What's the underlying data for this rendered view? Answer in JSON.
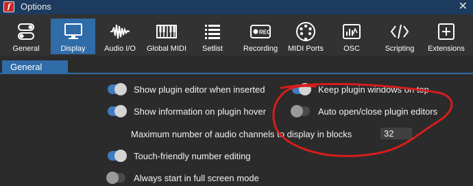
{
  "window": {
    "title": "Options",
    "close_glyph": "✕",
    "app_icon_letter": "f"
  },
  "toolbar": {
    "items": [
      {
        "label": "General",
        "icon": "toggles-icon",
        "active": false
      },
      {
        "label": "Display",
        "icon": "monitor-icon",
        "active": true
      },
      {
        "label": "Audio I/O",
        "icon": "waveform-icon",
        "active": false
      },
      {
        "label": "Global MIDI",
        "icon": "keyboard-icon",
        "active": false
      },
      {
        "label": "Setlist",
        "icon": "list-icon",
        "active": false
      },
      {
        "label": "Recording",
        "icon": "rec-icon",
        "active": false
      },
      {
        "label": "MIDI Ports",
        "icon": "midi-port-icon",
        "active": false
      },
      {
        "label": "OSC",
        "icon": "osc-icon",
        "active": false
      },
      {
        "label": "Scripting",
        "icon": "code-icon",
        "active": false
      },
      {
        "label": "Extensions",
        "icon": "plus-box-icon",
        "active": false
      }
    ],
    "rec_badge": "REC"
  },
  "tabs": {
    "general": "General"
  },
  "options": {
    "show_plugin_editor": {
      "label": "Show plugin editor when inserted",
      "on": true
    },
    "keep_plugin_windows": {
      "label": "Keep plugin windows on top",
      "on": true
    },
    "show_info_hover": {
      "label": "Show information on plugin hover",
      "on": true
    },
    "auto_open_close": {
      "label": "Auto open/close plugin editors",
      "on": false
    },
    "max_channels": {
      "label": "Maximum number of audio channels to display in blocks",
      "value": "32"
    },
    "touch_friendly": {
      "label": "Touch-friendly number editing",
      "on": true
    },
    "full_screen": {
      "label": "Always start in full screen mode",
      "on": false
    }
  },
  "colors": {
    "accent": "#2f6ca8",
    "annotation": "#d81c1c",
    "background": "#2b2b2b"
  }
}
